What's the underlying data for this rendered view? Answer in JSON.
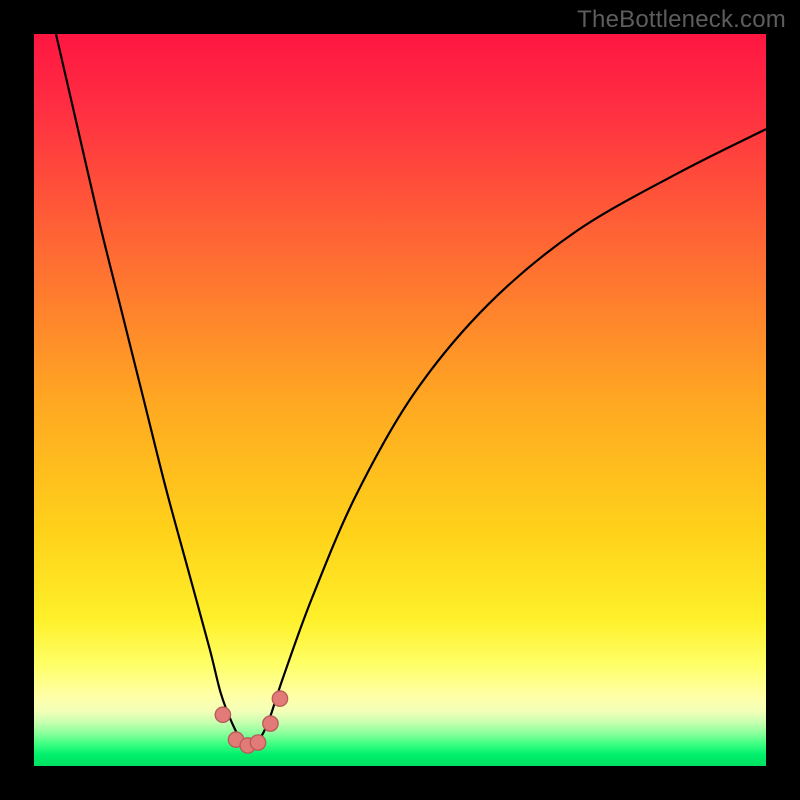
{
  "watermark": "TheBottleneck.com",
  "colors": {
    "frame": "#000000",
    "grad_top": "#ff1942",
    "grad_mid": "#ffa500",
    "grad_yellow": "#ffe300",
    "grad_paleyellow": "#ffff85",
    "grad_green": "#00e664",
    "curve_stroke": "#000000",
    "marker_fill": "#e27a78",
    "marker_stroke": "#b85a57"
  },
  "chart_data": {
    "type": "line",
    "title": "",
    "xlabel": "",
    "ylabel": "",
    "xlim": [
      0,
      100
    ],
    "ylim": [
      0,
      100
    ],
    "note": "axis values not labeled in source image; x/y are normalized 0–100",
    "series": [
      {
        "name": "bottleneck-curve",
        "x": [
          3,
          6,
          9,
          12,
          15,
          18,
          21,
          24,
          25.5,
          27,
          28.5,
          29.5,
          30.5,
          32,
          34,
          38,
          44,
          52,
          62,
          74,
          88,
          100
        ],
        "y": [
          100,
          87,
          74,
          62,
          50,
          38,
          27,
          16,
          10,
          6,
          3.2,
          2.6,
          3.2,
          6,
          12,
          23,
          37,
          51,
          63,
          73,
          81,
          87
        ]
      }
    ],
    "markers": {
      "name": "highlight-points",
      "points": [
        {
          "x": 25.8,
          "y": 7.0
        },
        {
          "x": 27.6,
          "y": 3.6
        },
        {
          "x": 29.2,
          "y": 2.8
        },
        {
          "x": 30.6,
          "y": 3.2
        },
        {
          "x": 32.3,
          "y": 5.8
        },
        {
          "x": 33.6,
          "y": 9.2
        }
      ]
    }
  }
}
